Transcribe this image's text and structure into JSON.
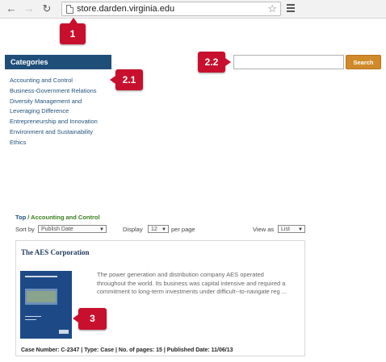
{
  "browser": {
    "url": "store.darden.virginia.edu"
  },
  "callouts": {
    "c1": "1",
    "c21": "2.1",
    "c22": "2.2",
    "c3": "3"
  },
  "categories": {
    "header": "Categories",
    "items": [
      "Accounting and Control",
      "Business-Government Relations",
      "Diversity Management and",
      "Leveraging Difference",
      "Entrepreneurship and Innovation",
      "Environment and Sustainability",
      "Ethics"
    ]
  },
  "search": {
    "value": "",
    "button_label": "Search"
  },
  "breadcrumb": {
    "top": "Top",
    "separator": " / ",
    "current": "Accounting and Control"
  },
  "controls": {
    "sort_label": "Sort by",
    "sort_value": "Publish Date",
    "display_label": "Display",
    "display_value": "12",
    "per_page_label": "per page",
    "view_label": "View as",
    "view_value": "List"
  },
  "product": {
    "title": "The AES Corporation",
    "description": "The power generation and distribution company AES operated throughout the world. Its business was capital intensive and required a commitment to long-term investments under difficult--to-navigate reg ...",
    "meta": "Case Number: C-2347 | Type: Case | No. of pages: 15 | Published Date: 11/06/13"
  },
  "colors": {
    "callout": "#c8102e",
    "category_header": "#1f4e79",
    "search_button": "#d08a2a",
    "breadcrumb_current": "#3a7d1e"
  }
}
